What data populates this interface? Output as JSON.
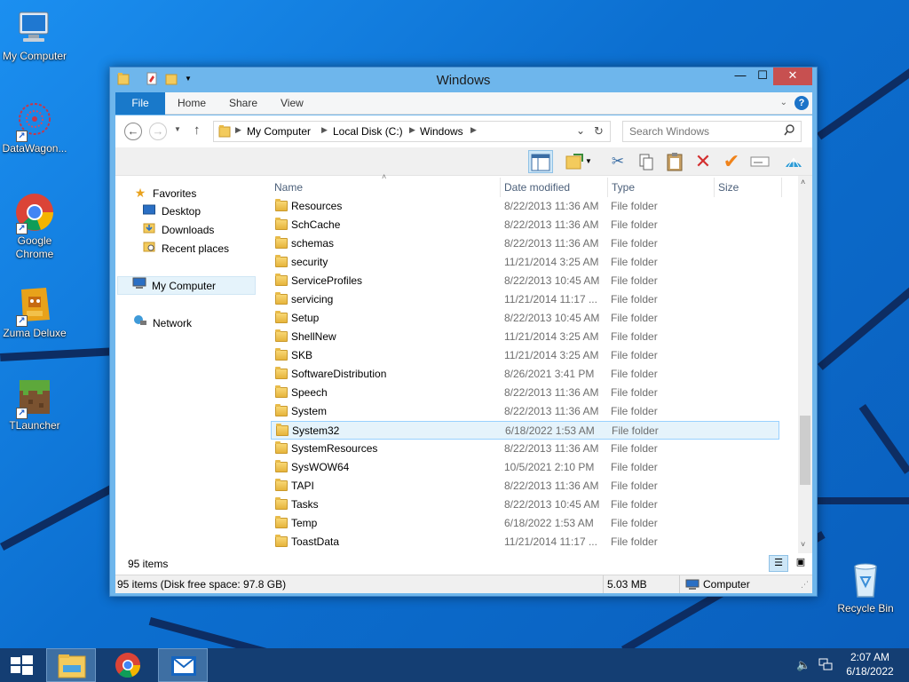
{
  "desktop": {
    "icons": [
      {
        "label": "My Computer",
        "icon": "computer-icon"
      },
      {
        "label": "DataWagon...",
        "icon": "datawagon-icon"
      },
      {
        "label": "Google Chrome",
        "icon": "chrome-icon"
      },
      {
        "label": "Zuma Deluxe",
        "icon": "zuma-icon"
      },
      {
        "label": "TLauncher",
        "icon": "minecraft-icon"
      },
      {
        "label": "Recycle Bin",
        "icon": "recycle-bin-icon"
      }
    ]
  },
  "window": {
    "title": "Windows",
    "controls": {
      "minimize": "—",
      "maximize": "☐",
      "close": "✕"
    },
    "ribbon_tabs": [
      "File",
      "Home",
      "Share",
      "View"
    ],
    "help": "?",
    "address": {
      "segments": [
        "My Computer",
        "Local Disk (C:)",
        "Windows"
      ],
      "separator": "▶"
    },
    "search": {
      "placeholder": "Search Windows"
    },
    "columns": [
      "Name",
      "Date modified",
      "Type",
      "Size"
    ],
    "files": [
      {
        "name": "Resources",
        "date": "8/22/2013 11:36 AM",
        "type": "File folder"
      },
      {
        "name": "SchCache",
        "date": "8/22/2013 11:36 AM",
        "type": "File folder"
      },
      {
        "name": "schemas",
        "date": "8/22/2013 11:36 AM",
        "type": "File folder"
      },
      {
        "name": "security",
        "date": "11/21/2014 3:25 AM",
        "type": "File folder"
      },
      {
        "name": "ServiceProfiles",
        "date": "8/22/2013 10:45 AM",
        "type": "File folder"
      },
      {
        "name": "servicing",
        "date": "11/21/2014 11:17 ...",
        "type": "File folder"
      },
      {
        "name": "Setup",
        "date": "8/22/2013 10:45 AM",
        "type": "File folder"
      },
      {
        "name": "ShellNew",
        "date": "11/21/2014 3:25 AM",
        "type": "File folder"
      },
      {
        "name": "SKB",
        "date": "11/21/2014 3:25 AM",
        "type": "File folder"
      },
      {
        "name": "SoftwareDistribution",
        "date": "8/26/2021 3:41 PM",
        "type": "File folder"
      },
      {
        "name": "Speech",
        "date": "8/22/2013 11:36 AM",
        "type": "File folder"
      },
      {
        "name": "System",
        "date": "8/22/2013 11:36 AM",
        "type": "File folder"
      },
      {
        "name": "System32",
        "date": "6/18/2022 1:53 AM",
        "type": "File folder",
        "selected": true
      },
      {
        "name": "SystemResources",
        "date": "8/22/2013 11:36 AM",
        "type": "File folder"
      },
      {
        "name": "SysWOW64",
        "date": "10/5/2021 2:10 PM",
        "type": "File folder"
      },
      {
        "name": "TAPI",
        "date": "8/22/2013 11:36 AM",
        "type": "File folder"
      },
      {
        "name": "Tasks",
        "date": "8/22/2013 10:45 AM",
        "type": "File folder"
      },
      {
        "name": "Temp",
        "date": "6/18/2022 1:53 AM",
        "type": "File folder"
      },
      {
        "name": "ToastData",
        "date": "11/21/2014 11:17 ...",
        "type": "File folder"
      }
    ],
    "nav": {
      "favorites": "Favorites",
      "desktop": "Desktop",
      "downloads": "Downloads",
      "recent": "Recent places",
      "computer": "My Computer",
      "network": "Network"
    },
    "item_count": "95 items",
    "status": {
      "left": "95 items (Disk free space: 97.8 GB)",
      "size": "5.03 MB",
      "location": "Computer"
    }
  },
  "taskbar": {
    "time": "2:07 AM",
    "date": "6/18/2022",
    "pinned": [
      "file-explorer-icon",
      "chrome-icon",
      "mail-icon"
    ]
  },
  "colors": {
    "accent": "#1979ca",
    "title_bar": "#6eb6ec",
    "close": "#c75050",
    "taskbar": "#143e73",
    "selection": "#e5f3fb"
  }
}
